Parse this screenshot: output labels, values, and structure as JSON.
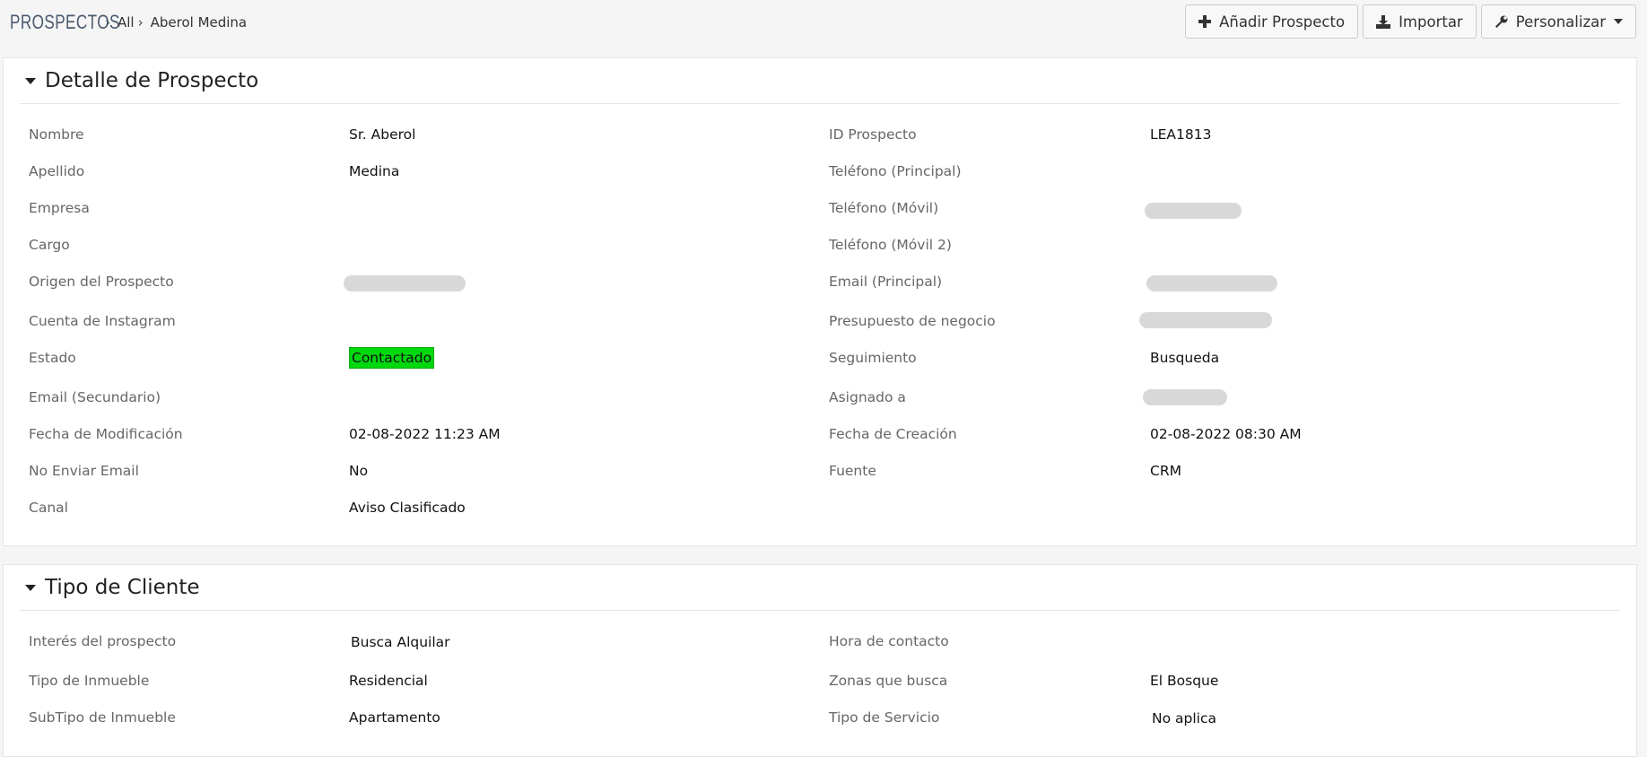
{
  "breadcrumb": {
    "module": "PROSPECTOS",
    "all": "All",
    "record": "Aberol Medina"
  },
  "toolbar": {
    "add_label": "Añadir Prospecto",
    "import_label": "Importar",
    "customize_label": "Personalizar"
  },
  "detail": {
    "title": "Detalle de Prospecto",
    "left": [
      {
        "label": "Nombre",
        "value": "Sr. Aberol"
      },
      {
        "label": "Apellido",
        "value": "Medina"
      },
      {
        "label": "Empresa",
        "value": ""
      },
      {
        "label": "Cargo",
        "value": ""
      },
      {
        "label": "Origen del Prospecto",
        "value": ""
      },
      {
        "label": "Cuenta de Instagram",
        "value": ""
      },
      {
        "label": "Estado",
        "value": "Contactado"
      },
      {
        "label": "Email (Secundario)",
        "value": ""
      },
      {
        "label": "Fecha de Modificación",
        "value": "02-08-2022 11:23 AM"
      },
      {
        "label": "No Enviar Email",
        "value": "No"
      },
      {
        "label": "Canal",
        "value": "Aviso Clasificado"
      }
    ],
    "right": [
      {
        "label": "ID Prospecto",
        "value": "LEA1813"
      },
      {
        "label": "Teléfono (Principal)",
        "value": ""
      },
      {
        "label": "Teléfono (Móvil)",
        "value": ""
      },
      {
        "label": "Teléfono (Móvil 2)",
        "value": ""
      },
      {
        "label": "Email (Principal)",
        "value": ""
      },
      {
        "label": "Presupuesto de negocio",
        "value": ""
      },
      {
        "label": "Seguimiento",
        "value": "Busqueda"
      },
      {
        "label": "Asignado a",
        "value": ""
      },
      {
        "label": "Fecha de Creación",
        "value": "02-08-2022 08:30 AM"
      },
      {
        "label": "Fuente",
        "value": "CRM"
      }
    ]
  },
  "client_type": {
    "title": "Tipo de Cliente",
    "left": [
      {
        "label": "Interés del prospecto",
        "value": "Busca Alquilar"
      },
      {
        "label": "Tipo de Inmueble",
        "value": "Residencial"
      },
      {
        "label": "SubTipo de Inmueble",
        "value": "Apartamento"
      }
    ],
    "right": [
      {
        "label": "Hora de contacto",
        "value": ""
      },
      {
        "label": "Zonas que busca",
        "value": "El Bosque"
      },
      {
        "label": "Tipo de Servicio",
        "value": "No aplica"
      }
    ]
  },
  "colors": {
    "status_contactado": "#00d80f",
    "redaction": "#d8d8d8",
    "module": "#4a5a6e"
  },
  "icons": {
    "add": "plus-icon",
    "import": "download-icon",
    "customize": "wrench-icon",
    "collapse": "caret-down-icon"
  }
}
